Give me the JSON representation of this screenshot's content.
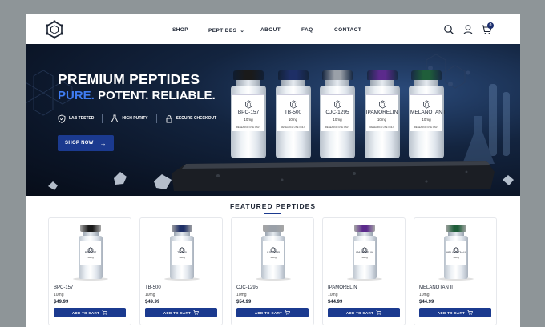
{
  "nav": {
    "shop": "SHOP",
    "peptides": "PEPTIDES",
    "about": "ABOUT",
    "faq": "FAQ",
    "contact": "CONTACT"
  },
  "header_icons": [
    "search-icon",
    "user-icon",
    "cart-icon"
  ],
  "cart_count": "0",
  "hero": {
    "title": "PREMIUM PEPTIDES",
    "sub_accent": "PURE.",
    "sub_rest": "POTENT. RELIABLE.",
    "badges": [
      "LAB TESTED",
      "HIGH PURITY",
      "SECURE CHECKOUT"
    ],
    "button_label": "SHOP NOW",
    "vials": [
      {
        "name": "BPC-157",
        "dose": "10mg",
        "note": "RESEARCH USE ONLY",
        "cap": "#1a1a1a"
      },
      {
        "name": "TB-500",
        "dose": "10mg",
        "note": "RESEARCH USE ONLY",
        "cap": "#1e2f66"
      },
      {
        "name": "CJC-1295",
        "dose": "10mg",
        "note": "RESEARCH USE ONLY",
        "cap": "#9aa0a8"
      },
      {
        "name": "IPAMORELIN",
        "dose": "10mg",
        "note": "RESEARCH USE ONLY",
        "cap": "#5b2a8c"
      },
      {
        "name": "MELANOTAN II",
        "dose": "10mg",
        "note": "RESEARCH USE ONLY",
        "cap": "#1f5e3a"
      }
    ]
  },
  "featured": {
    "title": "FEATURED PEPTIDES",
    "button_label": "ADD TO CART",
    "products": [
      {
        "name": "BPC-157",
        "dose": "10mg",
        "price": "$49.99",
        "cap": "#1a1a1a"
      },
      {
        "name": "TB-500",
        "dose": "10mg",
        "price": "$49.99",
        "cap": "#1e2f66"
      },
      {
        "name": "CJC-1295",
        "dose": "10mg",
        "price": "$54.99",
        "cap": "#9aa0a8"
      },
      {
        "name": "IPAMORELIN",
        "dose": "10mg",
        "price": "$44.99",
        "cap": "#5b2a8c"
      },
      {
        "name": "MELANOTAN II",
        "dose": "10mg",
        "price": "$44.99",
        "cap": "#1f5e3a"
      }
    ]
  },
  "colors": {
    "accent": "#1b3a8f",
    "accent_text": "#3f7cf2"
  }
}
